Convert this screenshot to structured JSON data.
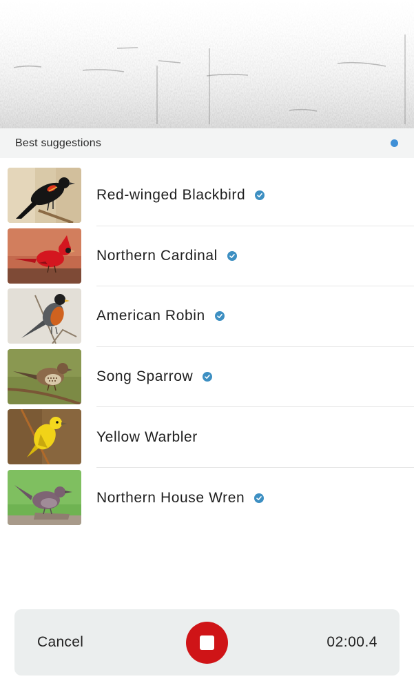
{
  "spectrogram": {
    "icon": "spectrogram-image"
  },
  "section": {
    "title": "Best suggestions",
    "live_indicator_color": "#3f8fd6"
  },
  "suggestions": [
    {
      "name": "Red-winged Blackbird",
      "verified": true,
      "photo": "red-winged-blackbird-photo"
    },
    {
      "name": "Northern Cardinal",
      "verified": true,
      "photo": "northern-cardinal-photo"
    },
    {
      "name": "American Robin",
      "verified": true,
      "photo": "american-robin-photo"
    },
    {
      "name": "Song Sparrow",
      "verified": true,
      "photo": "song-sparrow-photo"
    },
    {
      "name": "Yellow Warbler",
      "verified": false,
      "photo": "yellow-warbler-photo"
    },
    {
      "name": "Northern House Wren",
      "verified": true,
      "photo": "northern-house-wren-photo"
    }
  ],
  "controls": {
    "cancel_label": "Cancel",
    "timer": "02:00.4",
    "stop_icon": "stop-icon",
    "stop_color": "#cf1417"
  },
  "colors": {
    "verified_badge": "#3d8fc2"
  }
}
